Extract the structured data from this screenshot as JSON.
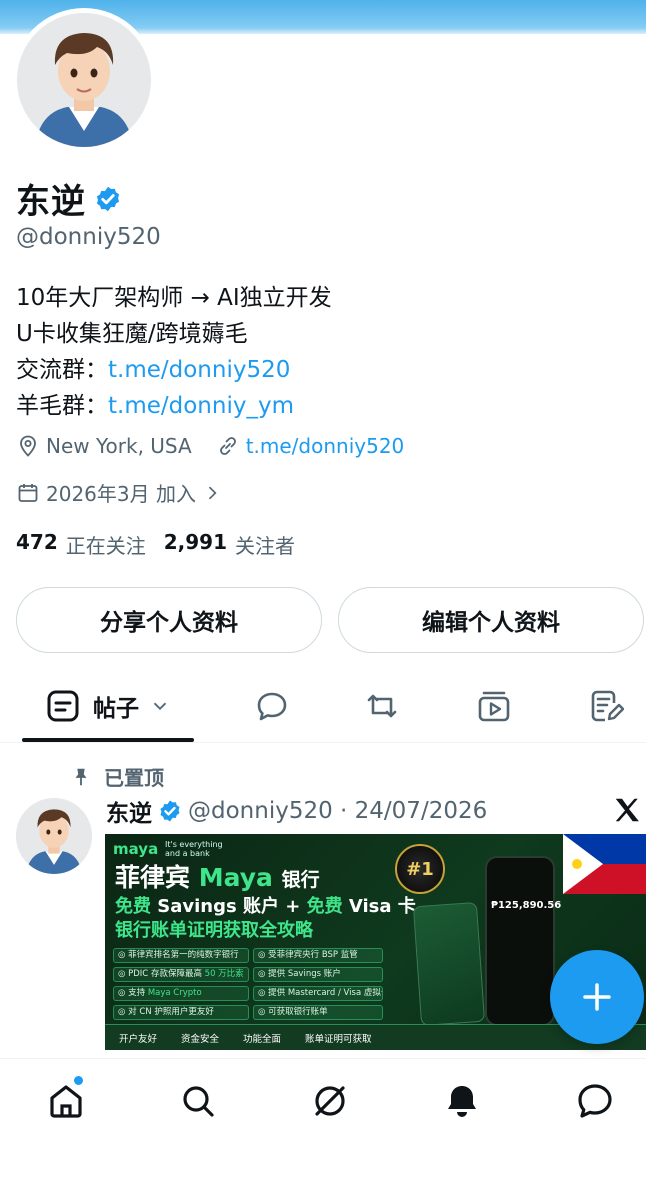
{
  "profile": {
    "name": "东逆",
    "handle": "@donniy520",
    "bio": [
      {
        "text": "10年大厂架构师 → AI独立开发",
        "link": ""
      },
      {
        "text": "U卡收集狂魔/跨境薅毛",
        "link": ""
      },
      {
        "text": "交流群：",
        "link": "t.me/donniy520"
      },
      {
        "text": "羊毛群：",
        "link": "t.me/donniy_ym"
      }
    ],
    "location": "New York, USA",
    "website": "t.me/donniy520",
    "joined": "2026年3月 加入",
    "following_count": "472",
    "following_label": "正在关注",
    "followers_count": "2,991",
    "followers_label": "关注者"
  },
  "actions": {
    "share_label": "分享个人资料",
    "edit_label": "编辑个人资料"
  },
  "tabs": {
    "posts_label": "帖子",
    "icons": [
      "posts-icon",
      "replies-icon",
      "reposts-icon",
      "media-icon",
      "articles-icon"
    ]
  },
  "pinned_post": {
    "pinned_label": "已置顶",
    "author": "东逆",
    "handle_date": "@donniy520 · 24/07/2026",
    "image": {
      "brand": "maya",
      "tagline": "It's everything and a bank",
      "headline_prefix": "菲律宾",
      "headline_brand": "Maya",
      "headline_suffix": "银行",
      "line2_free1": "免费",
      "line2_mid": " Savings 账户 + ",
      "line2_free2": "免费",
      "line2_end": " Visa 卡",
      "line3": "银行账单证明获取全攻略",
      "badge": "#1",
      "phone_amount": "₱125,890.56",
      "features_left": [
        {
          "prefix": "菲律宾排名第一的纯数字银行",
          "hl": ""
        },
        {
          "prefix": "PDIC 存款保障最高 ",
          "hl": "50 万比索"
        },
        {
          "prefix": "支持 ",
          "hl": "Maya Crypto"
        },
        {
          "prefix": "对 CN 护照用户更友好",
          "hl": ""
        }
      ],
      "features_right": [
        {
          "prefix": "受菲律宾央行 BSP 监管",
          "hl": ""
        },
        {
          "prefix": "提供 Savings 账户",
          "hl": ""
        },
        {
          "prefix": "提供 Mastercard / Visa 虚拟卡",
          "hl": ""
        },
        {
          "prefix": "可获取银行账单",
          "hl": ""
        }
      ],
      "bottom": [
        "开户友好",
        "资金安全",
        "功能全面",
        "账单证明可获取"
      ]
    }
  },
  "nav": {
    "items": [
      "home-icon",
      "search-icon",
      "grok-icon",
      "notifications-icon",
      "messages-icon"
    ]
  },
  "colors": {
    "accent": "#1d9bf0",
    "text": "#0f1419",
    "muted": "#536471"
  }
}
